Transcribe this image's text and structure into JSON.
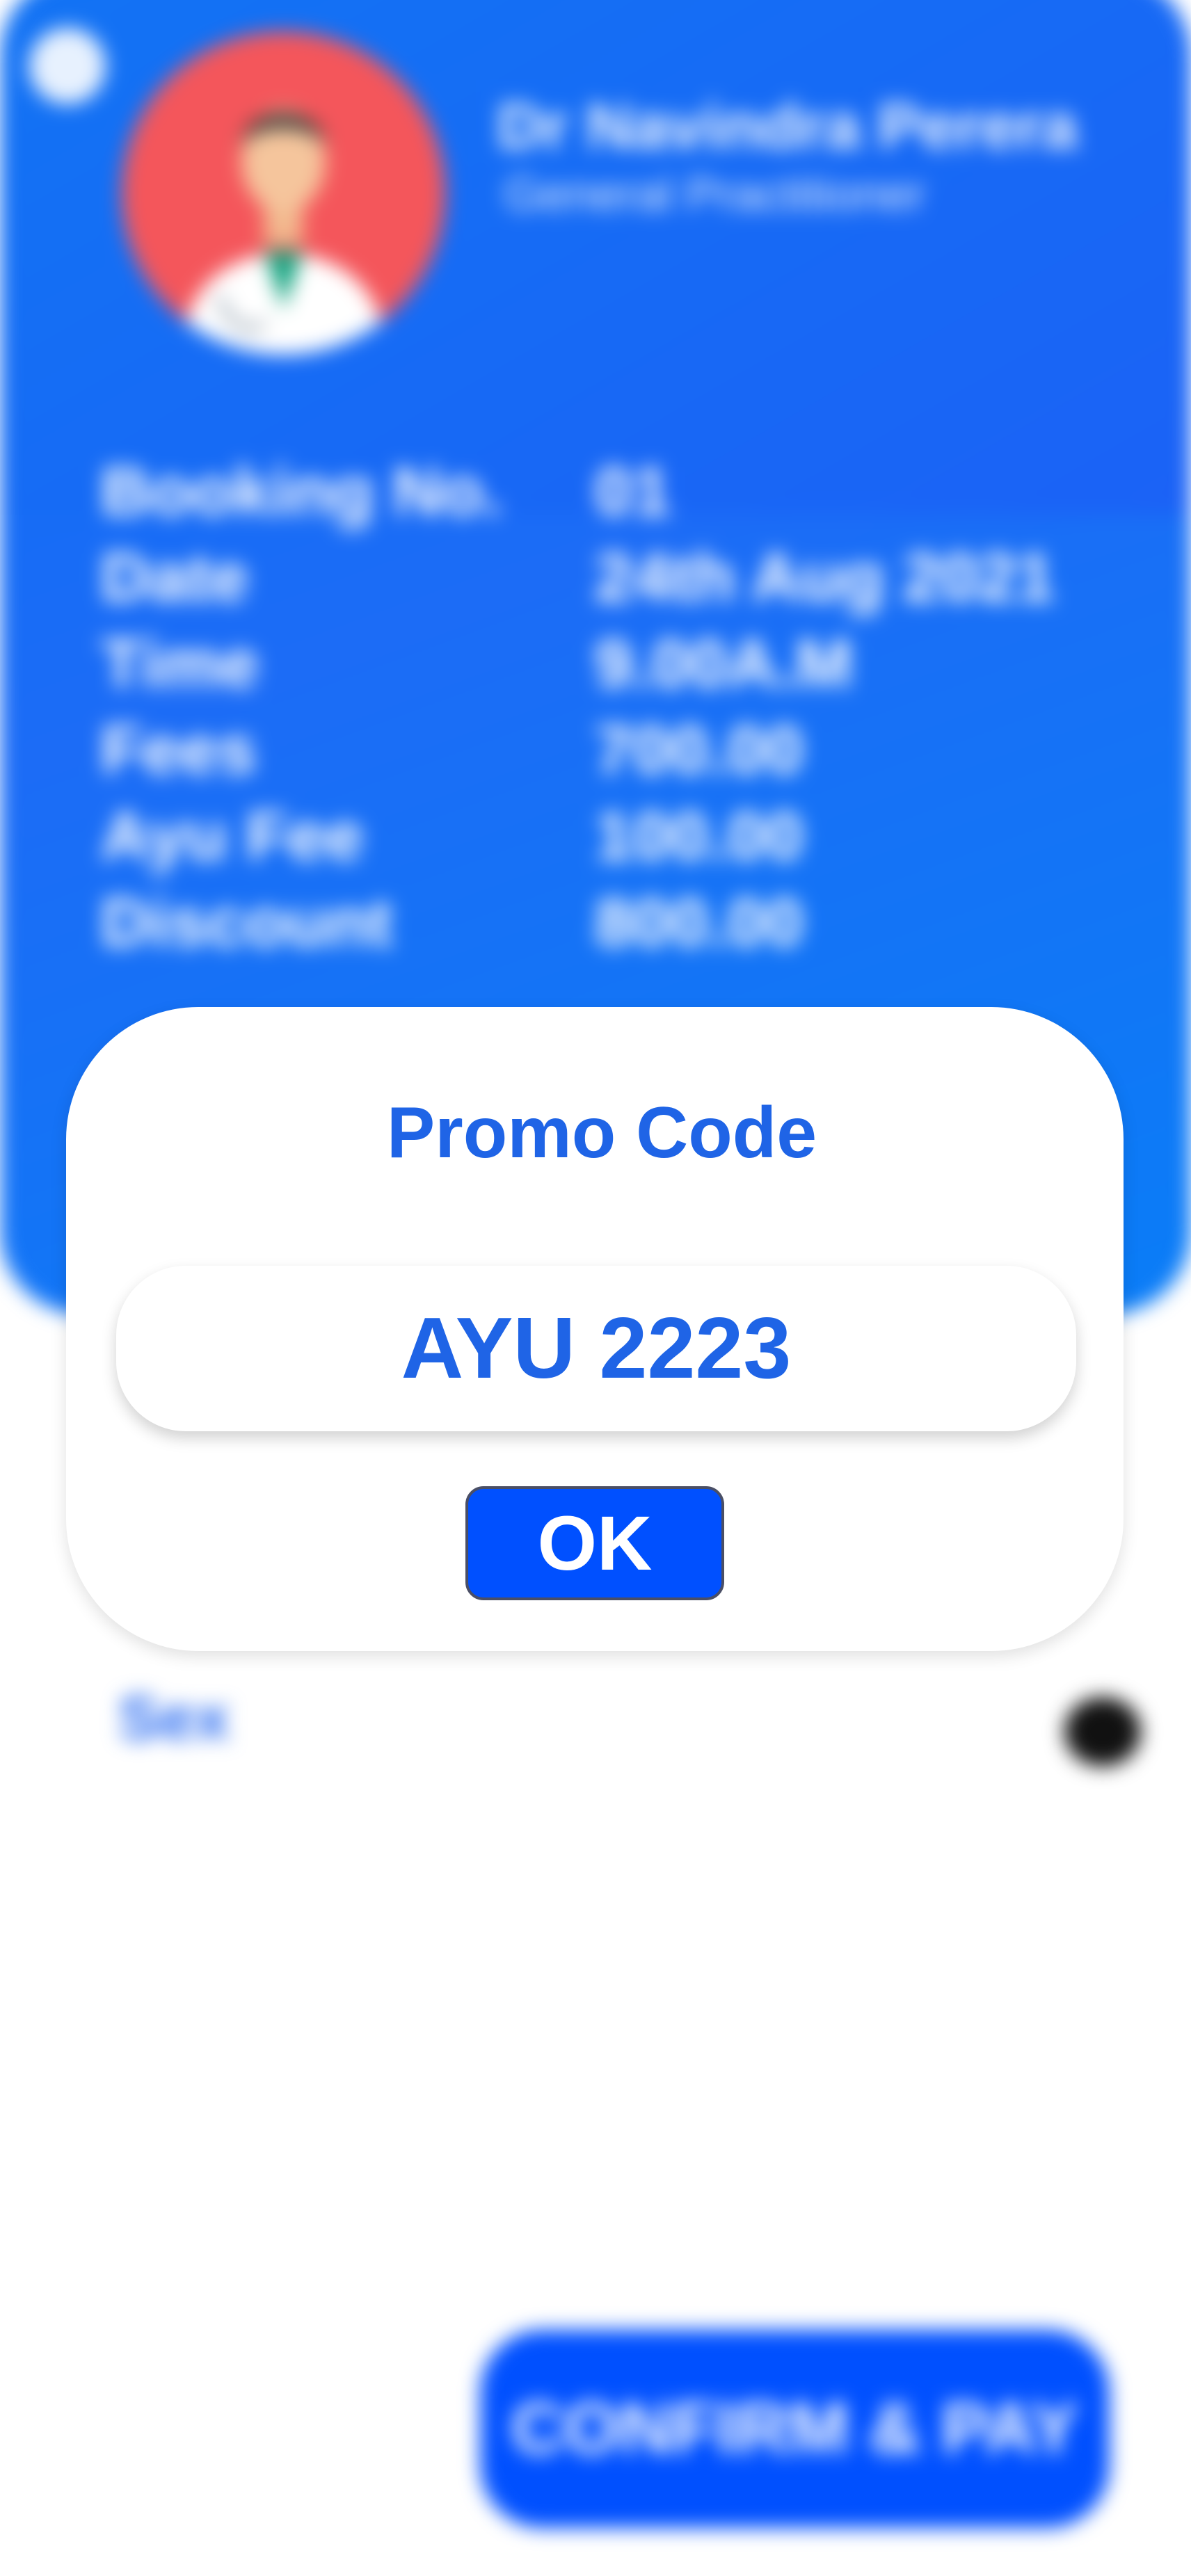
{
  "background": {
    "doctor": {
      "name": "Dr Navindra  Perera",
      "title": "General Practitioner"
    },
    "details": [
      {
        "label": "Booking No.",
        "value": "01"
      },
      {
        "label": "Date",
        "value": "24th Aug 2021"
      },
      {
        "label": "Time",
        "value": "9.00A.M"
      },
      {
        "label": "Fees",
        "value": "700.00"
      },
      {
        "label": "Ayu Fee",
        "value": "100.00"
      },
      {
        "label": "Discount",
        "value": "800.00"
      }
    ],
    "form": {
      "sex_label": "Sex"
    },
    "confirm_label": "CONFIRM & PAY"
  },
  "modal": {
    "title": "Promo Code",
    "promo_value": "AYU 2223",
    "ok_label": "OK"
  },
  "colors": {
    "card_blue": "#1c6cf6",
    "accent_blue": "#1f64e6",
    "button_blue": "#0050ff",
    "avatar_red": "#f4565b"
  }
}
